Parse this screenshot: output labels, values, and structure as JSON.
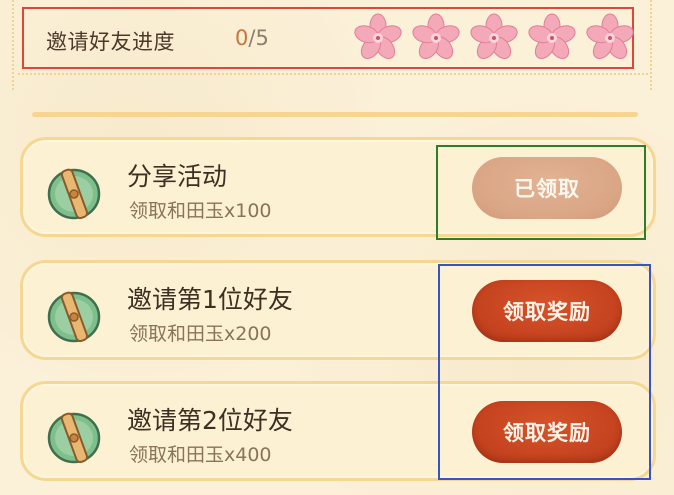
{
  "progress": {
    "label": "邀请好友进度",
    "current": "0",
    "total": "/5",
    "flowers": [
      "flower-icon",
      "flower-icon",
      "flower-icon",
      "flower-icon",
      "flower-icon"
    ]
  },
  "tasks": [
    {
      "title": "分享活动",
      "reward": "领取和田玉x100",
      "button": "已领取",
      "state": "claimed"
    },
    {
      "title": "邀请第1位好友",
      "reward": "领取和田玉x200",
      "button": "领取奖励",
      "state": "claimable"
    },
    {
      "title": "邀请第2位好友",
      "reward": "领取和田玉x400",
      "button": "领取奖励",
      "state": "claimable"
    }
  ],
  "colors": {
    "annotation_red": "#e0453a",
    "annotation_green": "#2f7d2a",
    "annotation_blue": "#3554c8",
    "claim_button": "#c5431f",
    "claimed_button": "#d9a585"
  }
}
